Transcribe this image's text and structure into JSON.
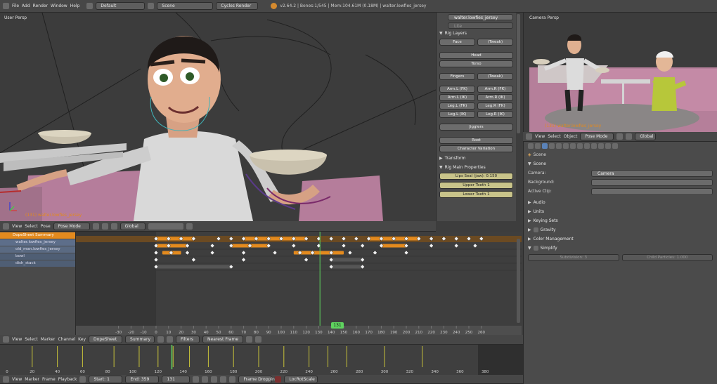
{
  "topbar": {
    "menus": [
      "File",
      "Add",
      "Render",
      "Window",
      "Help"
    ],
    "layout": "Default",
    "scene": "Scene",
    "engine": "Cycles Render",
    "stats": "v2.64.2 | Bones:1/545 | Mem:104.61M (0.18M) | walter.lowfies_jersey"
  },
  "viewport": {
    "label": "User Persp",
    "object_label": "(131) walter.lowfies_jersey",
    "header": {
      "menus": [
        "View",
        "Select",
        "Pose"
      ],
      "mode": "Pose Mode",
      "orientation": "Global"
    }
  },
  "rig_panel": {
    "object_field": "walter.lowfies_jersey",
    "search_placeholder": "Lite",
    "rig_layers_title": "Rig Layers",
    "buttons": {
      "face": "Face",
      "face_tweak": "(Tweak)",
      "head": "Head",
      "torso": "Torso",
      "fingers": "Fingers",
      "fingers_tweak": "(Tweak)",
      "arm_l_fk": "Arm.L (FK)",
      "arm_r_fk": "Arm.R (FK)",
      "arm_l_ik": "Arm.L (IK)",
      "arm_r_ik": "Arm.R (IK)",
      "leg_l_fk": "Leg.L (FK)",
      "leg_r_fk": "Leg.R (FK)",
      "leg_l_ik": "Leg.L (IK)",
      "leg_r_ik": "Leg.R (IK)",
      "jigglers": "Jigglers",
      "root": "Root",
      "char_var": "Character Variation"
    },
    "transform_title": "Transform",
    "rig_main_title": "Rig Main Properties",
    "lips_seal": "Lips Seal (jaw): 0.150",
    "upper_teeth": "Upper Teeth 1",
    "lower_teeth": "Lower Teeth 1"
  },
  "camera_view": {
    "label": "Camera Persp",
    "object_label": "(131) walter.lowfies_jersey"
  },
  "properties": {
    "header": {
      "menus": [
        "View",
        "Select",
        "Object"
      ],
      "mode": "Pose Mode",
      "orientation": "Global"
    },
    "context": "Scene",
    "scene_title": "Scene",
    "camera_label": "Camera:",
    "camera_value": "Camera",
    "background_label": "Background:",
    "active_clip_label": "Active Clip:",
    "sections": [
      "Audio",
      "Units",
      "Keying Sets",
      "Gravity",
      "Color Management",
      "Simplify"
    ],
    "subdivision": "Subdivision: 3",
    "child_particles": "Child Particles: 1.000"
  },
  "dopesheet": {
    "channels": [
      "DopeSheet Summary",
      "walter.lowfies_jersey",
      "old_man.lowfies_jersey",
      "bowl",
      "dish_stack"
    ],
    "ruler_ticks": [
      -30,
      -20,
      -10,
      0,
      10,
      20,
      30,
      40,
      50,
      60,
      70,
      80,
      90,
      100,
      110,
      120,
      130,
      140,
      150,
      160,
      170,
      180,
      190,
      200,
      210,
      220,
      230,
      240,
      250,
      260
    ],
    "current_frame": "131",
    "header": {
      "menus": [
        "View",
        "Select",
        "Marker",
        "Channel",
        "Key"
      ],
      "mode": "DopeSheet",
      "summary": "Summary",
      "filters": "Filters",
      "snap": "Nearest Frame"
    }
  },
  "timeline": {
    "ruler_ticks": [
      0,
      20,
      40,
      60,
      80,
      100,
      120,
      140,
      160,
      180,
      200,
      220,
      240,
      260,
      280,
      300,
      320,
      340,
      360,
      380
    ],
    "header": {
      "menus": [
        "View",
        "Marker",
        "Frame",
        "Playback"
      ],
      "start": "Start: 1",
      "end": "End: 359",
      "frame": "131",
      "sync": "Frame Dropping",
      "keyset": "LocRotScale"
    }
  },
  "colors": {
    "accent": "#e38a1e",
    "current_frame": "#5fd35f",
    "bg": "#3d3d3d",
    "keyframe": "#f0f0f0"
  }
}
